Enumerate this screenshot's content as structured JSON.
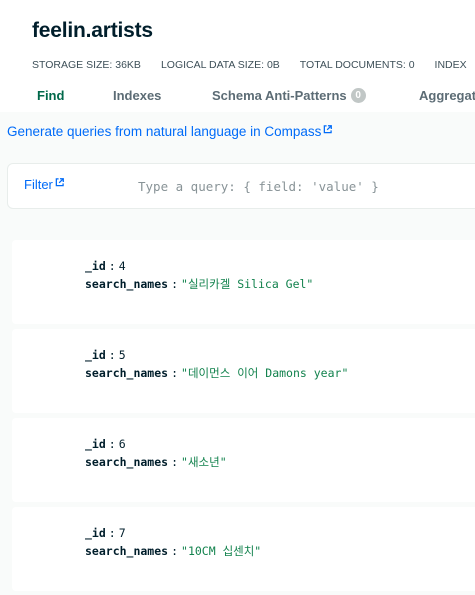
{
  "collection": {
    "title": "feelin.artists"
  },
  "stats": [
    {
      "label": "STORAGE SIZE:",
      "value": "36KB"
    },
    {
      "label": "LOGICAL DATA SIZE:",
      "value": "0B"
    },
    {
      "label": "TOTAL DOCUMENTS:",
      "value": "0"
    },
    {
      "label": "INDEX",
      "value": ""
    }
  ],
  "tabs": {
    "find": "Find",
    "indexes": "Indexes",
    "schema": "Schema Anti-Patterns",
    "schema_count": "0",
    "aggregations": "Aggregat"
  },
  "nl_query": {
    "label": "Generate queries from natural language in Compass"
  },
  "filter": {
    "label": "Filter",
    "placeholder": "Type a query: { field: 'value' }"
  },
  "documents": [
    {
      "id_key": "_id",
      "id_value": "4",
      "name_key": "search_names",
      "name_value": "\"실리카겔 Silica Gel\""
    },
    {
      "id_key": "_id",
      "id_value": "5",
      "name_key": "search_names",
      "name_value": "\"데이먼스 이어 Damons year\""
    },
    {
      "id_key": "_id",
      "id_value": "6",
      "name_key": "search_names",
      "name_value": "\"새소년\""
    },
    {
      "id_key": "_id",
      "id_value": "7",
      "name_key": "search_names",
      "name_value": "\"10CM 십센치\""
    }
  ],
  "colors": {
    "accent_green": "#00684a",
    "link_blue": "#016bf8",
    "string_green": "#12824d"
  }
}
